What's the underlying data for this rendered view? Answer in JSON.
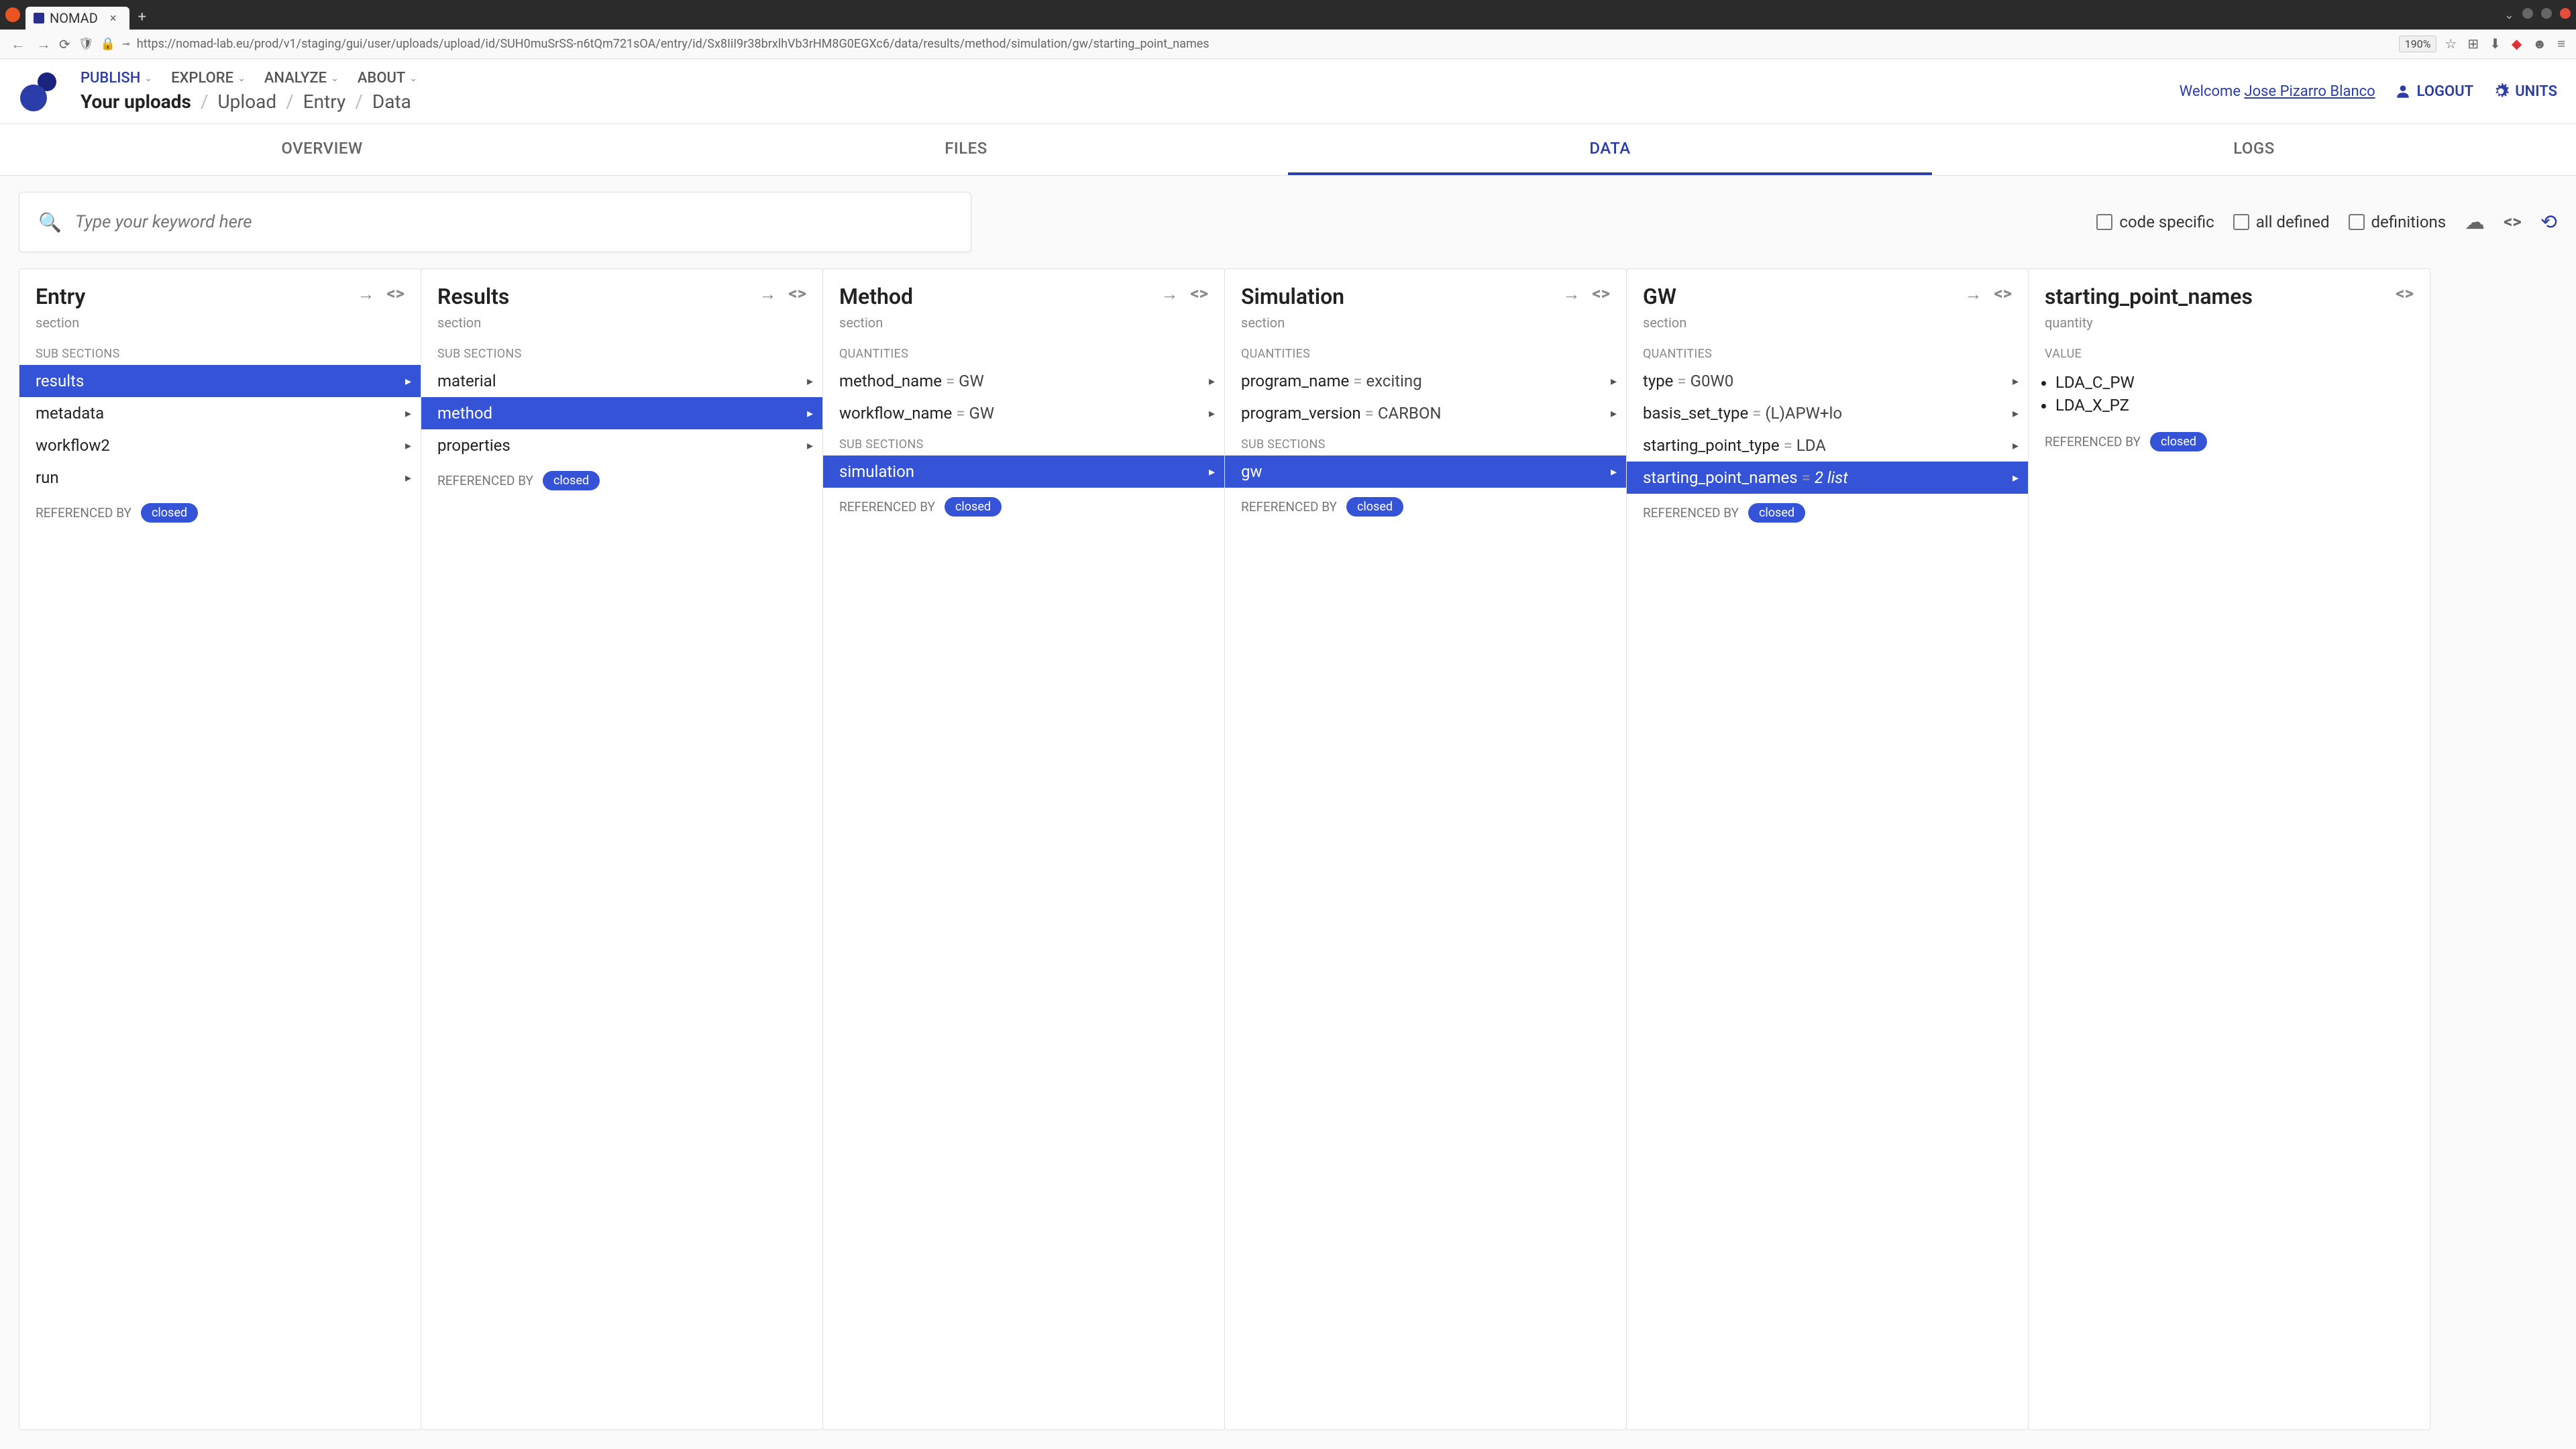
{
  "browser": {
    "tab_title": "NOMAD",
    "url": "https://nomad-lab.eu/prod/v1/staging/gui/user/uploads/upload/id/SUH0muSrSS-n6tQm721sOA/entry/id/Sx8IiI9r38brxlhVb3rHM8G0EGXc6/data/results/method/simulation/gw/starting_point_names",
    "zoom": "190%"
  },
  "nav": {
    "items": [
      "PUBLISH",
      "EXPLORE",
      "ANALYZE",
      "ABOUT"
    ],
    "active": "PUBLISH"
  },
  "breadcrumb": {
    "main": "Your uploads",
    "parts": [
      "Upload",
      "Entry",
      "Data"
    ]
  },
  "header": {
    "welcome_prefix": "Welcome ",
    "user": "Jose Pizarro Blanco",
    "logout": "LOGOUT",
    "units": "UNITS"
  },
  "tabs": {
    "items": [
      "OVERVIEW",
      "FILES",
      "DATA",
      "LOGS"
    ],
    "active": "DATA"
  },
  "search": {
    "placeholder": "Type your keyword here"
  },
  "filters": {
    "code_specific": "code specific",
    "all_defined": "all defined",
    "definitions": "definitions"
  },
  "columns": [
    {
      "title": "Entry",
      "subtitle": "section",
      "section_label": "SUB SECTIONS",
      "rows": [
        {
          "label": "results",
          "selected": true,
          "has_children": true
        },
        {
          "label": "metadata",
          "has_children": true
        },
        {
          "label": "workflow2",
          "has_children": true
        },
        {
          "label": "run",
          "has_children": true
        }
      ],
      "ref_by": "REFERENCED BY",
      "ref_badge": "closed"
    },
    {
      "title": "Results",
      "subtitle": "section",
      "section_label": "SUB SECTIONS",
      "rows": [
        {
          "label": "material",
          "has_children": true
        },
        {
          "label": "method",
          "selected": true,
          "has_children": true
        },
        {
          "label": "properties",
          "has_children": true
        }
      ],
      "ref_by": "REFERENCED BY",
      "ref_badge": "closed"
    },
    {
      "title": "Method",
      "subtitle": "section",
      "quantities_label": "QUANTITIES",
      "quantities": [
        {
          "label": "method_name",
          "value": "GW",
          "has_children": true
        },
        {
          "label": "workflow_name",
          "value": "GW",
          "has_children": true
        }
      ],
      "section_label": "SUB SECTIONS",
      "rows": [
        {
          "label": "simulation",
          "selected": true,
          "has_children": true
        }
      ],
      "ref_by": "REFERENCED BY",
      "ref_badge": "closed"
    },
    {
      "title": "Simulation",
      "subtitle": "section",
      "quantities_label": "QUANTITIES",
      "quantities": [
        {
          "label": "program_name",
          "value": "exciting",
          "has_children": true
        },
        {
          "label": "program_version",
          "value": "CARBON",
          "has_children": true
        }
      ],
      "section_label": "SUB SECTIONS",
      "rows": [
        {
          "label": "gw",
          "selected": true,
          "has_children": true
        }
      ],
      "ref_by": "REFERENCED BY",
      "ref_badge": "closed"
    },
    {
      "title": "GW",
      "subtitle": "section",
      "quantities_label": "QUANTITIES",
      "quantities": [
        {
          "label": "type",
          "value": "G0W0",
          "has_children": true
        },
        {
          "label": "basis_set_type",
          "value": "(L)APW+lo",
          "has_children": true
        },
        {
          "label": "starting_point_type",
          "value": "LDA",
          "has_children": true
        },
        {
          "label": "starting_point_names",
          "value": "2 list",
          "selected": true,
          "italic_value": true,
          "has_children": true
        }
      ],
      "ref_by": "REFERENCED BY",
      "ref_badge": "closed"
    },
    {
      "title": "starting_point_names",
      "subtitle": "quantity",
      "value_label": "VALUE",
      "values": [
        "LDA_C_PW",
        "LDA_X_PZ"
      ],
      "ref_by": "REFERENCED BY",
      "ref_badge": "closed",
      "no_nav_arrow": true
    }
  ]
}
